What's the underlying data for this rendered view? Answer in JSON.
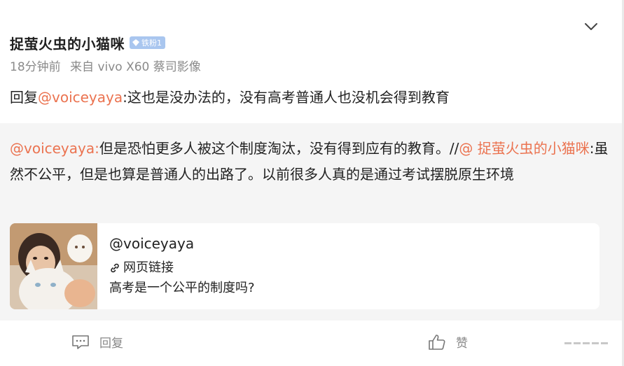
{
  "header": {
    "username": "捉萤火虫的小猫咪",
    "fan_badge": "铁粉1",
    "time": "18分钟前",
    "source": "来自 vivo X60 蔡司影像"
  },
  "reply": {
    "prefix": "回复",
    "mention": "@voiceyaya",
    "text": ":这也是没办法的，没有高考普通人也没机会得到教育"
  },
  "quote": {
    "mention1": "@voiceyaya:",
    "text1": "但是恐怕更多人被这个制度淘汰，没有得到应有的教育。//",
    "mention2": "@ 捉萤火虫的小猫咪",
    "text2": ":虽然不公平，但是也算是普通人的出路了。以前很多人真的是通过考试摆脱原生环境"
  },
  "link_card": {
    "author": "@voiceyaya",
    "type_label": "网页链接",
    "title": "高考是一个公平的制度吗?",
    "icon": "link-icon"
  },
  "actions": {
    "reply_label": "回复",
    "like_label": "赞",
    "reply_icon": "comment-icon",
    "like_icon": "thumbs-up-icon",
    "more_icon": "more-dots-icon"
  },
  "colors": {
    "mention": "#eb7350",
    "quote_bg": "#f5f5f5",
    "meta_text": "#8a8a8a",
    "badge_bg": "#a9c6ef"
  }
}
